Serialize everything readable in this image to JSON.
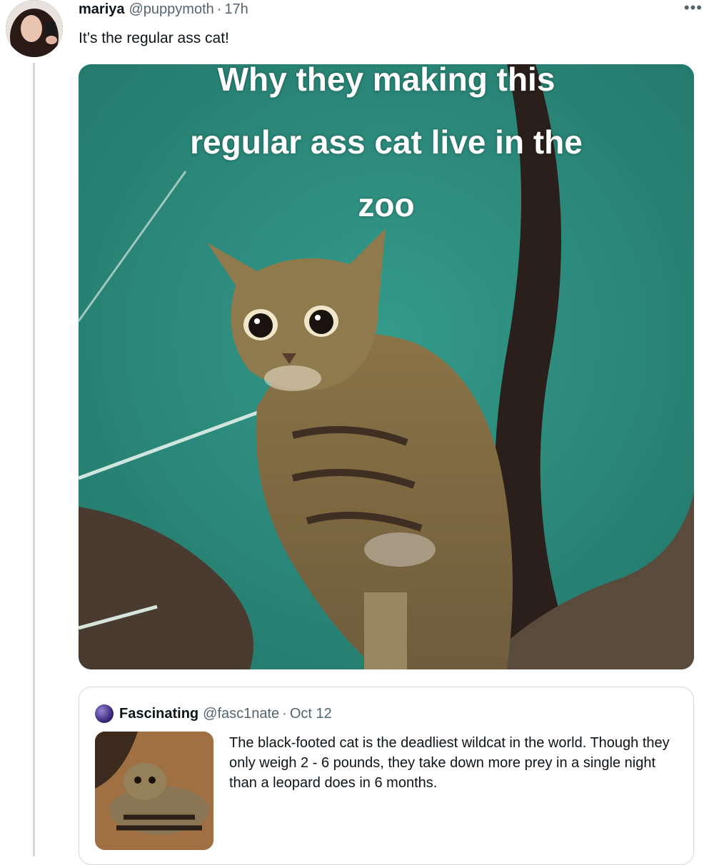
{
  "tweet": {
    "display_name": "mariya",
    "handle": "@puppymoth",
    "separator": "·",
    "time": "17h",
    "text": "It’s the regular ass cat!",
    "more_icon": "more-icon",
    "media_caption": {
      "line1": "Why they making this",
      "line2": "regular ass cat live in the",
      "line3": "zoo"
    }
  },
  "quote": {
    "display_name": "Fascinating",
    "handle": "@fasc1nate",
    "separator": "·",
    "date": "Oct 12",
    "text": "The black-footed cat is the deadliest wildcat in the world. Though they only weigh 2 - 6 pounds, they take down more prey in a single night than a leopard does in 6 months."
  },
  "colors": {
    "media_background": "#2e8a7c",
    "secondary_text": "#536471",
    "border": "#cfd9de"
  }
}
